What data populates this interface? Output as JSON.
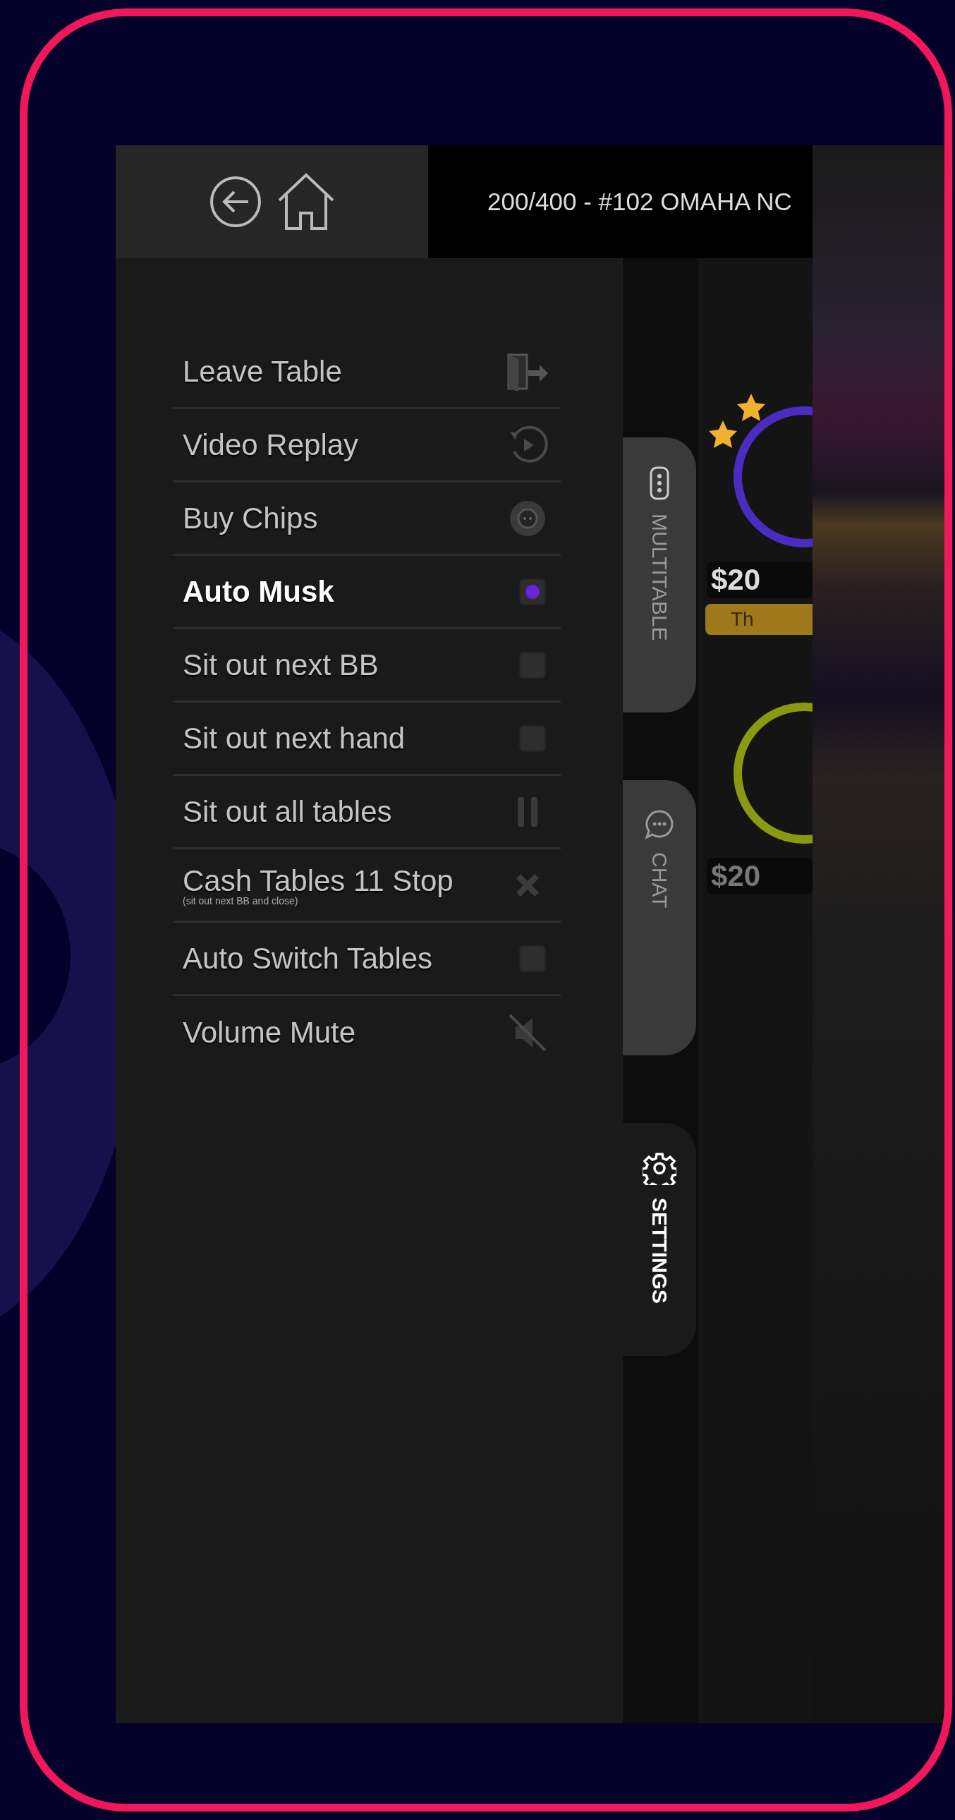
{
  "header": {
    "title": "200/400 - #102 OMAHA NC"
  },
  "menu": {
    "items": [
      {
        "kind": "leave",
        "label": "Leave Table"
      },
      {
        "kind": "replay",
        "label": "Video Replay"
      },
      {
        "kind": "chips",
        "label": "Buy Chips"
      },
      {
        "kind": "toggle",
        "label": "Auto Musk",
        "checked": true
      },
      {
        "kind": "toggle",
        "label": "Sit out next BB",
        "checked": false
      },
      {
        "kind": "toggle",
        "label": "Sit out next hand",
        "checked": false
      },
      {
        "kind": "pause",
        "label": "Sit out all tables"
      },
      {
        "kind": "stop",
        "label": "Cash Tables 11 Stop",
        "note": "(sit out next BB and close)"
      },
      {
        "kind": "toggle",
        "label": "Auto Switch Tables",
        "checked": false
      },
      {
        "kind": "mute",
        "label": "Volume Mute"
      }
    ]
  },
  "tabs": [
    {
      "kind": "table",
      "label": "MULTITABLE",
      "selected": false
    },
    {
      "kind": "chat",
      "label": "CHAT",
      "selected": false
    },
    {
      "kind": "settings",
      "label": "SETTINGS",
      "selected": true
    }
  ],
  "table": {
    "seats": [
      {
        "stack": "$20",
        "banner": "Th",
        "color": "#4a2cc0"
      },
      {
        "stack": "$20",
        "color": "#8a9a10"
      }
    ]
  }
}
